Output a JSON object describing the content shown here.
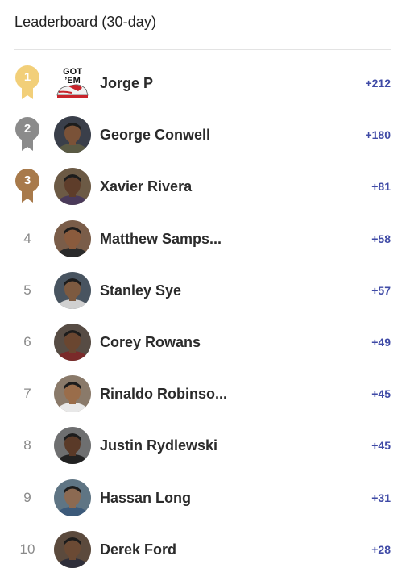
{
  "header": {
    "title": "Leaderboard (30-day)"
  },
  "colors": {
    "gold": "#f2cf79",
    "silver": "#8b8b8b",
    "bronze": "#a87a4b",
    "points": "#3f4aa6"
  },
  "entries": [
    {
      "rank": "1",
      "medal": "gold",
      "name": "Jorge P",
      "points": "+212",
      "avatar": "sneaker-logo",
      "avatar_text": "GOT 'EM"
    },
    {
      "rank": "2",
      "medal": "silver",
      "name": "George Conwell",
      "points": "+180",
      "avatar": "person-photo"
    },
    {
      "rank": "3",
      "medal": "bronze",
      "name": "Xavier Rivera",
      "points": "+81",
      "avatar": "person-photo"
    },
    {
      "rank": "4",
      "medal": "",
      "name": "Matthew Samps...",
      "points": "+58",
      "avatar": "person-photo"
    },
    {
      "rank": "5",
      "medal": "",
      "name": "Stanley Sye",
      "points": "+57",
      "avatar": "person-photo"
    },
    {
      "rank": "6",
      "medal": "",
      "name": "Corey Rowans",
      "points": "+49",
      "avatar": "person-photo"
    },
    {
      "rank": "7",
      "medal": "",
      "name": "Rinaldo Robinso...",
      "points": "+45",
      "avatar": "person-photo"
    },
    {
      "rank": "8",
      "medal": "",
      "name": "Justin Rydlewski",
      "points": "+45",
      "avatar": "person-photo"
    },
    {
      "rank": "9",
      "medal": "",
      "name": "Hassan Long",
      "points": "+31",
      "avatar": "person-photo"
    },
    {
      "rank": "10",
      "medal": "",
      "name": "Derek Ford",
      "points": "+28",
      "avatar": "person-photo"
    }
  ]
}
